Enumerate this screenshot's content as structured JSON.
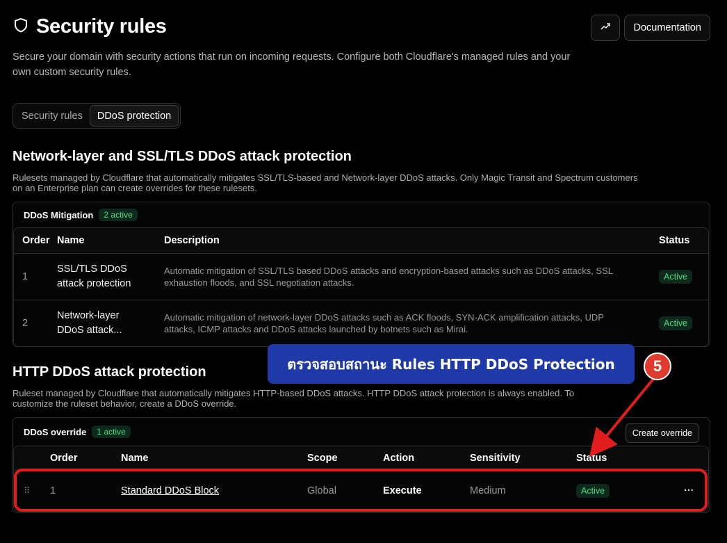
{
  "header": {
    "title": "Security rules",
    "subtitle": "Secure your domain with security actions that run on incoming requests. Configure both Cloudflare's managed rules and your own custom security rules.",
    "documentation_label": "Documentation"
  },
  "tabs": [
    {
      "label": "Security rules",
      "active": false
    },
    {
      "label": "DDoS protection",
      "active": true
    }
  ],
  "network_section": {
    "title": "Network-layer and SSL/TLS DDoS attack protection",
    "description": "Rulesets managed by Cloudflare that automatically mitigates SSL/TLS-based and Network-layer DDoS attacks. Only Magic Transit and Spectrum customers on an Enterprise plan can create overrides for these rulesets.",
    "card_name": "DDoS Mitigation",
    "badge": "2 active",
    "columns": {
      "order": "Order",
      "name": "Name",
      "description": "Description",
      "status": "Status"
    },
    "rows": [
      {
        "order": "1",
        "name_line1": "SSL/TLS DDoS",
        "name_line2": "attack protection",
        "description": "Automatic mitigation of SSL/TLS based DDoS attacks and encryption-based attacks such as DDoS attacks, SSL exhaustion floods, and SSL negotiation attacks.",
        "status": "Active"
      },
      {
        "order": "2",
        "name_line1": "Network-layer",
        "name_line2": "DDoS attack...",
        "description": "Automatic mitigation of network-layer DDoS attacks such as ACK floods, SYN-ACK amplification attacks, UDP attacks, ICMP attacks and DDoS attacks launched by botnets such as Mirai.",
        "status": "Active"
      }
    ]
  },
  "http_section": {
    "title": "HTTP DDoS attack protection",
    "description": "Ruleset managed by Cloudflare that automatically mitigates HTTP-based DDoS attacks. HTTP DDoS attack protection is always enabled. To customize the ruleset behavior, create a DDoS override.",
    "card_name": "DDoS override",
    "badge": "1 active",
    "create_button": "Create override",
    "columns": {
      "order": "Order",
      "name": "Name",
      "scope": "Scope",
      "action": "Action",
      "sensitivity": "Sensitivity",
      "status": "Status"
    },
    "rows": [
      {
        "order": "1",
        "name": "Standard DDoS Block",
        "scope": "Global",
        "action": "Execute",
        "sensitivity": "Medium",
        "status": "Active",
        "menu": "···"
      }
    ]
  },
  "annotation": {
    "callout_text": "ตรวจสอบสถานะ Rules HTTP DDoS Protection",
    "step_number": "5",
    "highlight_color": "#e11d1d",
    "callout_color": "#1f3aa8"
  },
  "colors": {
    "background": "#000000",
    "active_green": "#4ade80",
    "badge_bg": "#0f2a1c"
  }
}
